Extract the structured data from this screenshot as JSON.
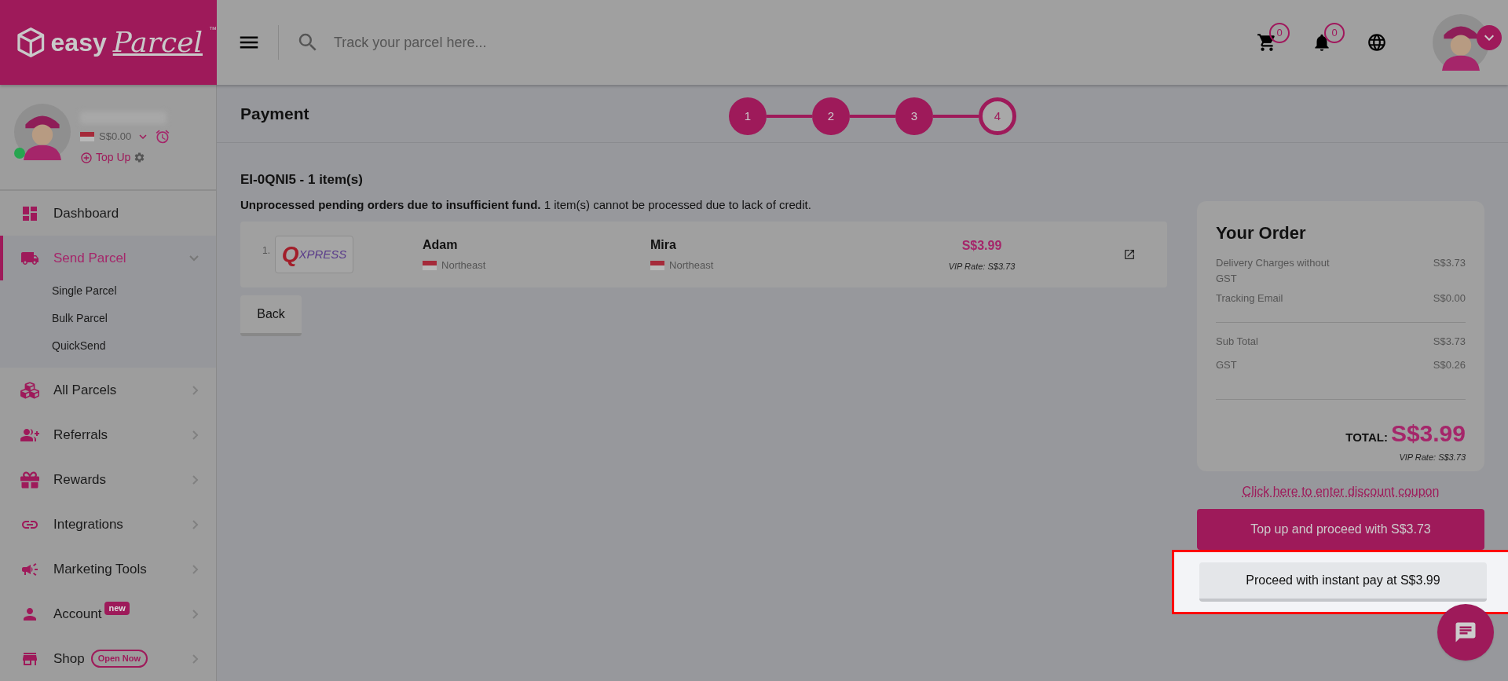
{
  "logo": {
    "word1": "easy",
    "word2": "Parcel",
    "mark": "™"
  },
  "search": {
    "placeholder": "Track your parcel here..."
  },
  "header_icons": [
    {
      "kind": "cart",
      "count": "0"
    },
    {
      "kind": "bell",
      "count": "0"
    },
    {
      "kind": "globe"
    }
  ],
  "profile": {
    "online": true,
    "balance": "S$0.00",
    "top_up": "Top Up"
  },
  "sidebar": {
    "items": [
      {
        "kind": "dashboard",
        "label": "Dashboard",
        "selected": false
      },
      {
        "kind": "truck",
        "label": "Send Parcel",
        "selected": true,
        "expanded": true,
        "children": [
          {
            "label": "Single Parcel"
          },
          {
            "label": "Bulk Parcel"
          },
          {
            "label": "QuickSend"
          }
        ]
      },
      {
        "kind": "cubes",
        "label": "All Parcels",
        "selected": false,
        "expanded": false
      },
      {
        "kind": "referral",
        "label": "Referrals",
        "selected": false,
        "expanded": false
      },
      {
        "kind": "gift",
        "label": "Rewards",
        "selected": false,
        "expanded": false
      },
      {
        "kind": "link",
        "label": "Integrations",
        "selected": false,
        "expanded": false
      },
      {
        "kind": "megaphone",
        "label": "Marketing Tools",
        "selected": false,
        "expanded": false
      },
      {
        "kind": "person",
        "label": "Account",
        "selected": false,
        "expanded": false,
        "badge": {
          "kind": "filled",
          "text": "new"
        }
      },
      {
        "kind": "store",
        "label": "Shop",
        "selected": false,
        "expanded": false,
        "badge": {
          "kind": "outline",
          "text": "Open Now"
        }
      }
    ]
  },
  "page_title": "Payment",
  "steps": [
    {
      "label": "1",
      "done": true
    },
    {
      "label": "2",
      "done": true
    },
    {
      "label": "3",
      "done": true
    },
    {
      "label": "4",
      "done": false
    }
  ],
  "batch": {
    "title": "EI-0QNI5 - 1 item(s)",
    "notice": "**Unprocessed pending orders due to insufficient fund.** 1 item(s) cannot be processed due to lack of credit.",
    "orders": [
      {
        "index": "1.",
        "courier_logo": {
          "q": "Q",
          "rest": "XPRESS"
        },
        "sender": "Adam",
        "sender_region": "Northeast",
        "receiver": "Mira",
        "receiver_region": "Northeast",
        "price": "S$3.99",
        "vip_rate": "VIP Rate: S$3.73"
      }
    ]
  },
  "back_button": "Back",
  "order_summary": {
    "title": "Your Order",
    "lines": [
      {
        "label": "Delivery Charges without GST",
        "value": "S$3.73"
      },
      {
        "label": "Tracking Email",
        "value": "S$0.00"
      }
    ],
    "subtotals": [
      {
        "label": "Sub Total",
        "value": "S$3.73"
      },
      {
        "label": "GST",
        "value": "S$0.26"
      }
    ],
    "total_label": "TOTAL:",
    "total": "S$3.99",
    "vip_rate": "VIP Rate: S$3.73"
  },
  "coupon_link": "Click here to enter discount coupon",
  "topup_button": "Top up and proceed with S$3.73",
  "instant_pay_button": {
    "label": "Proceed with instant pay at S$3.99",
    "highlighted": true
  }
}
